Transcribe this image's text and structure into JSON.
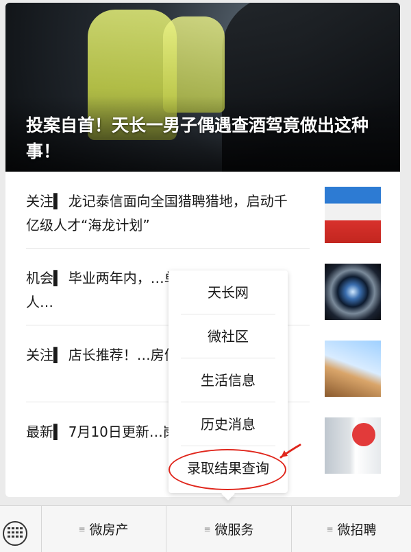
{
  "hero": {
    "title": "投案自首！天长一男子偶遇查酒驾竟做出这种事！"
  },
  "articles": [
    {
      "text": "关注▍ 龙记泰信面向全国猎聘猎地，启动千亿级人才“海龙计划”",
      "thumb": "event-photo"
    },
    {
      "text": "机会▍ 毕业两年内，…单位招募 40 名见习人…",
      "thumb": "camera-lens-photo"
    },
    {
      "text": "关注▍ 店长推荐！…房信息【天长网】",
      "thumb": "house-photo"
    },
    {
      "text": "最新▍ 7月10日更新…岗位【天长网】",
      "thumb": "job-fair-photo"
    }
  ],
  "menu": {
    "items": [
      "天长网",
      "微社区",
      "生活信息",
      "历史消息",
      "录取结果查询"
    ]
  },
  "bottom_bar": {
    "keyboard_icon": "keyboard-icon",
    "tabs": [
      "微房产",
      "微服务",
      "微招聘"
    ]
  },
  "colors": {
    "annotation": "#e0261c",
    "background": "#ebebeb"
  }
}
